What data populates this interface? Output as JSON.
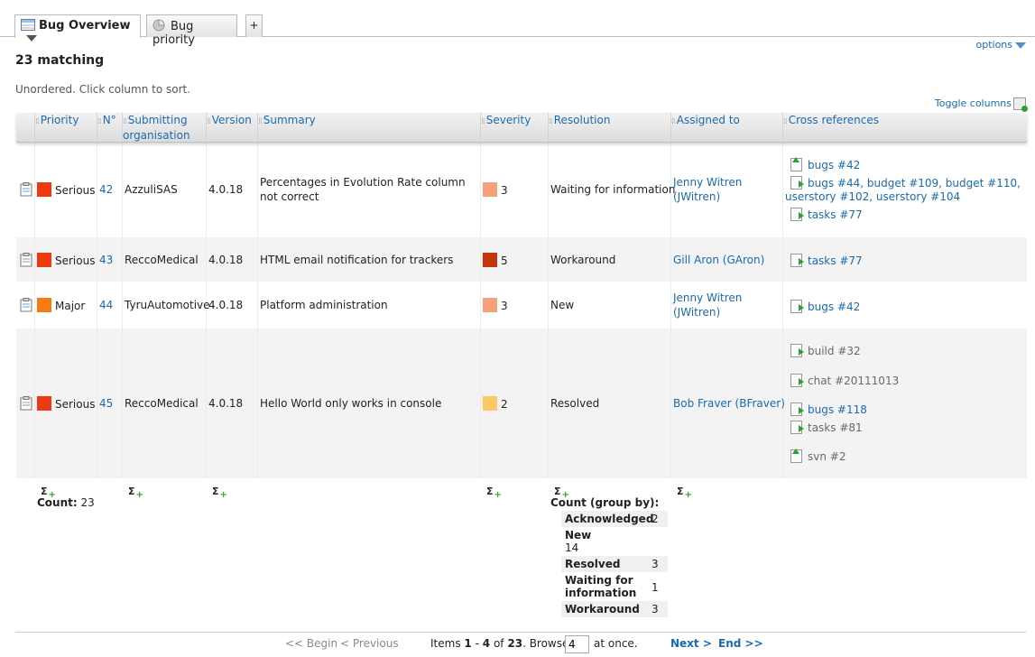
{
  "tabs": [
    {
      "label": "Bug Overview",
      "active": true
    },
    {
      "label": "Bug priority",
      "active": false
    }
  ],
  "add_tab_label": "+",
  "options_label": "options",
  "matching_label": "23 matching",
  "sort_note": "Unordered. Click column to sort.",
  "toggle_columns_label": "Toggle columns",
  "columns": {
    "priority": "Priority",
    "number": "N°",
    "submitting_1": "Submitting",
    "submitting_2": "organisation",
    "version": "Version",
    "summary": "Summary",
    "severity": "Severity",
    "resolution": "Resolution",
    "assigned": "Assigned to",
    "xref": "Cross references"
  },
  "colors": {
    "serious": "#ee3a12",
    "major": "#f57d16",
    "sev3": "#f7a07a",
    "sev5": "#c73409",
    "sev2": "#fdc868",
    "link": "#1a6ab0"
  },
  "rows": [
    {
      "priority": "Serious",
      "number": "42",
      "org": "AzzuliSAS",
      "version": "4.0.18",
      "summary_1": "Percentages in Evolution Rate column",
      "summary_2": "not correct",
      "severity": "3",
      "resolution": "Waiting for information",
      "assigned_1": "Jenny Witren",
      "assigned_2": "(JWitren)",
      "xrefs": [
        "bugs #42",
        "bugs #44, budget #109, budget #110,",
        "userstory #102, userstory #104",
        "tasks #77"
      ]
    },
    {
      "priority": "Serious",
      "number": "43",
      "org": "ReccoMedical",
      "version": "4.0.18",
      "summary_1": "HTML email notification for trackers",
      "severity": "5",
      "resolution": "Workaround",
      "assigned_1": "Gill Aron (GAron)",
      "xrefs": [
        "tasks #77"
      ]
    },
    {
      "priority": "Major",
      "number": "44",
      "org": "TyruAutomotive",
      "version": "4.0.18",
      "summary_1": "Platform administration",
      "severity": "3",
      "resolution": "New",
      "assigned_1": "Jenny Witren",
      "assigned_2": "(JWitren)",
      "xrefs": [
        "bugs #42"
      ]
    },
    {
      "priority": "Serious",
      "number": "45",
      "org": "ReccoMedical",
      "version": "4.0.18",
      "summary_1": "Hello World only works in console",
      "severity": "2",
      "resolution": "Resolved",
      "assigned_1": "Bob Fraver (BFraver)",
      "xrefs": [
        "build #32",
        "chat #20111013",
        "bugs #118",
        "tasks #81",
        "svn #2"
      ]
    }
  ],
  "sums": {
    "count_label": "Count:",
    "count_value": "23",
    "group_by_label": "Count (group by):",
    "groups": [
      {
        "label": "Acknowledged",
        "value": "2"
      },
      {
        "label": "New",
        "value": "14"
      },
      {
        "label": "Resolved",
        "value": "3"
      },
      {
        "label": "Waiting for information",
        "value": "1"
      },
      {
        "label": "Workaround",
        "value": "3"
      }
    ]
  },
  "pager": {
    "begin": "<< Begin",
    "previous": "< Previous",
    "items_prefix": "Items",
    "range_from": "1",
    "range_sep": "-",
    "range_to": "4",
    "of_label": "of",
    "total": "23",
    "browse_label": ". Browse",
    "browse_value": "4",
    "at_once": "at once.",
    "next": "Next >",
    "end": "End >>"
  }
}
